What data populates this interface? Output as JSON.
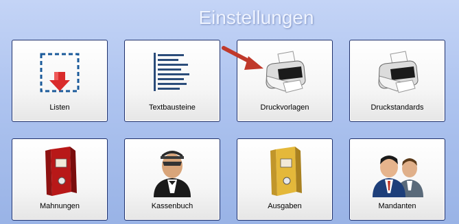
{
  "page": {
    "title": "Einstellungen"
  },
  "tiles": [
    {
      "label": "Listen",
      "icon": "list-download-icon"
    },
    {
      "label": "Textbausteine",
      "icon": "text-blocks-icon"
    },
    {
      "label": "Druckvorlagen",
      "icon": "printer-icon"
    },
    {
      "label": "Druckstandards",
      "icon": "printer-icon"
    },
    {
      "label": "Mahnungen",
      "icon": "red-binder-icon"
    },
    {
      "label": "Kassenbuch",
      "icon": "cashier-person-icon"
    },
    {
      "label": "Ausgaben",
      "icon": "yellow-binder-icon"
    },
    {
      "label": "Mandanten",
      "icon": "clients-people-icon"
    }
  ],
  "colors": {
    "tile_border": "#1d2f6a",
    "arrow": "#c0392b",
    "background": "#adc3ef"
  }
}
